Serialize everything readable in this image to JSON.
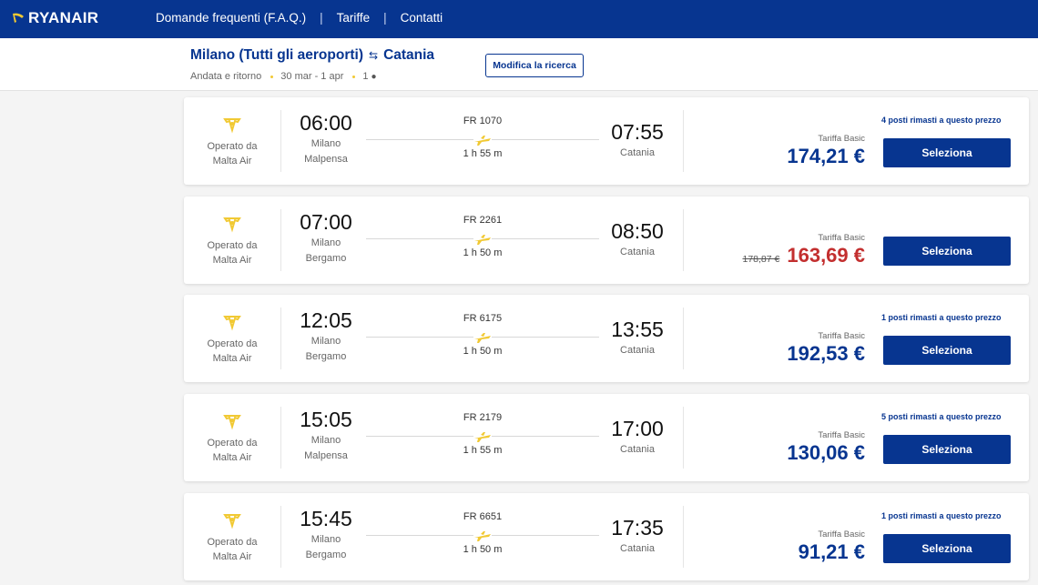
{
  "brand": {
    "name": "RYANAIR",
    "logo_icon": "harp-icon",
    "nav_color": "#073590",
    "accent": "#f1c933"
  },
  "nav": [
    "Domande frequenti (F.A.Q.)",
    "Tariffe",
    "Contatti"
  ],
  "search": {
    "origin": "Milano (Tutti gli aeroporti)",
    "destination": "Catania",
    "trip_type": "Andata e ritorno",
    "dates": "30 mar - 1 apr",
    "passengers": "1",
    "modify_label": "Modifica la ricerca"
  },
  "flights": [
    {
      "operator_label": "Operato da",
      "operator": "Malta Air",
      "dep_time": "06:00",
      "dep_city": "Milano",
      "dep_airport": "Malpensa",
      "flight_no": "FR 1070",
      "duration": "1 h 55 m",
      "arr_time": "07:55",
      "arr_city": "Catania",
      "fare_label": "Tariffa Basic",
      "old_price": "",
      "price": "174,21 €",
      "seats": "4 posti rimasti a questo prezzo",
      "select_label": "Seleziona"
    },
    {
      "operator_label": "Operato da",
      "operator": "Malta Air",
      "dep_time": "07:00",
      "dep_city": "Milano",
      "dep_airport": "Bergamo",
      "flight_no": "FR 2261",
      "duration": "1 h 50 m",
      "arr_time": "08:50",
      "arr_city": "Catania",
      "fare_label": "Tariffa Basic",
      "old_price": "178,87 €",
      "price": "163,69 €",
      "seats": "",
      "select_label": "Seleziona"
    },
    {
      "operator_label": "Operato da",
      "operator": "Malta Air",
      "dep_time": "12:05",
      "dep_city": "Milano",
      "dep_airport": "Bergamo",
      "flight_no": "FR 6175",
      "duration": "1 h 50 m",
      "arr_time": "13:55",
      "arr_city": "Catania",
      "fare_label": "Tariffa Basic",
      "old_price": "",
      "price": "192,53 €",
      "seats": "1 posti rimasti a questo prezzo",
      "select_label": "Seleziona"
    },
    {
      "operator_label": "Operato da",
      "operator": "Malta Air",
      "dep_time": "15:05",
      "dep_city": "Milano",
      "dep_airport": "Malpensa",
      "flight_no": "FR 2179",
      "duration": "1 h 55 m",
      "arr_time": "17:00",
      "arr_city": "Catania",
      "fare_label": "Tariffa Basic",
      "old_price": "",
      "price": "130,06 €",
      "seats": "5 posti rimasti a questo prezzo",
      "select_label": "Seleziona"
    },
    {
      "operator_label": "Operato da",
      "operator": "Malta Air",
      "dep_time": "15:45",
      "dep_city": "Milano",
      "dep_airport": "Bergamo",
      "flight_no": "FR 6651",
      "duration": "1 h 50 m",
      "arr_time": "17:35",
      "arr_city": "Catania",
      "fare_label": "Tariffa Basic",
      "old_price": "",
      "price": "91,21 €",
      "seats": "1 posti rimasti a questo prezzo",
      "select_label": "Seleziona"
    }
  ]
}
